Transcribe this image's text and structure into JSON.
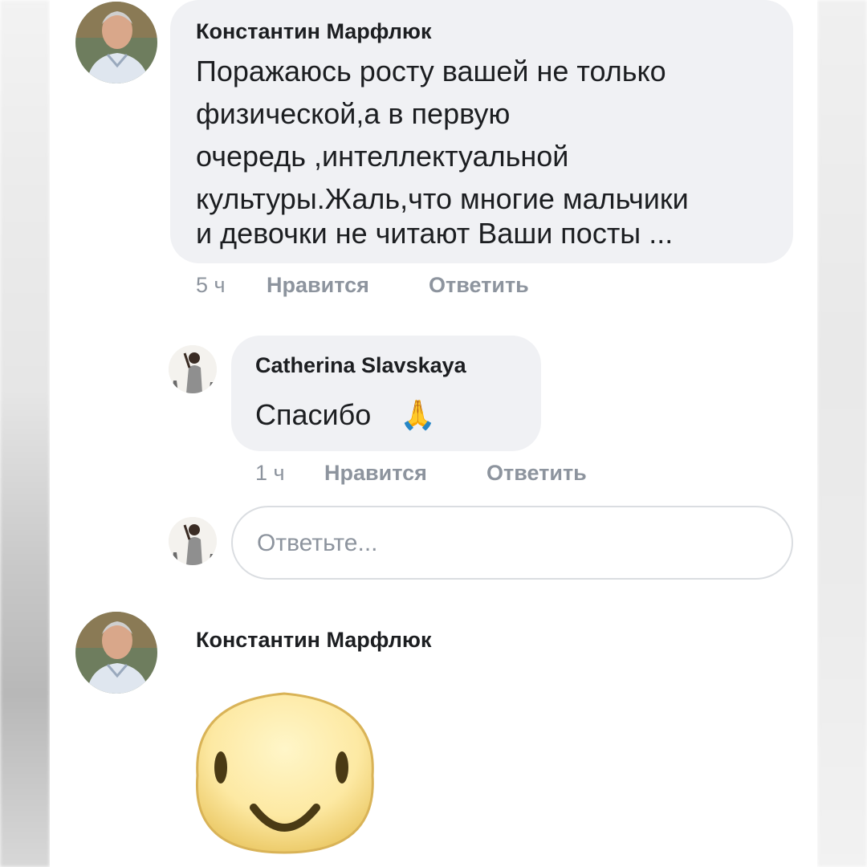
{
  "comment": {
    "author": "Константин Марфлюк",
    "lines": [
      "Поражаюсь росту вашей не только",
      "физической,а в первую",
      "очередь ,интеллектуальной",
      "культуры.Жаль,что многие мальчики",
      "и девочки не читают Ваши посты ..."
    ],
    "time": "5 ч",
    "like_label": "Нравится",
    "reply_label": "Ответить"
  },
  "reply": {
    "author": "Catherina Slavskaya",
    "text": "Спасибо",
    "emoji": "🙏",
    "time": "1 ч",
    "like_label": "Нравится",
    "reply_label": "Ответить"
  },
  "reply_input": {
    "placeholder": "Ответьте..."
  },
  "comment2": {
    "author": "Константин Марфлюк",
    "sticker": "smile-sticker"
  },
  "colors": {
    "bubble": "#f0f1f4",
    "text": "#1c1e21",
    "meta": "#8d949e",
    "sticker": "#fbe7a1"
  }
}
